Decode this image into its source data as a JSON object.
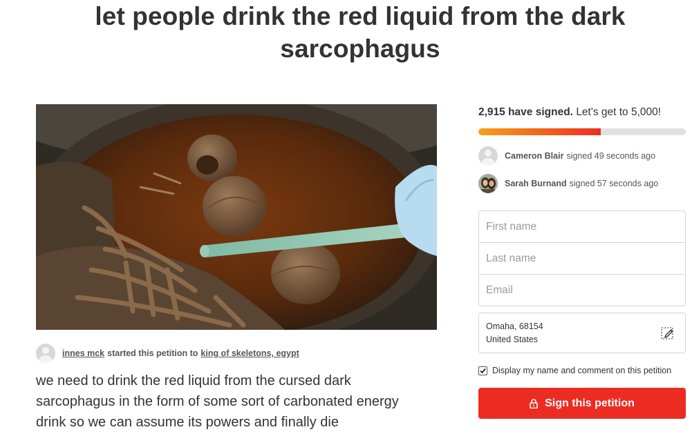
{
  "petition": {
    "title": "let people drink the red liquid from the dark sarcophagus",
    "starter_name": "innes mck",
    "starter_mid": "started this petition to",
    "target": "king of skeletons, egypt",
    "description": "we need to drink the red liquid from the cursed dark sarcophagus in the form of some sort of carbonated energy drink so we can assume its powers and finally die"
  },
  "signatures": {
    "count_text": "2,915 have signed.",
    "goal_text": "Let's get to 5,000!",
    "progress_fraction": 0.59,
    "recent": [
      {
        "name": "Cameron Blair",
        "action": "signed 49 seconds ago",
        "avatar": "default-user-icon"
      },
      {
        "name": "Sarah Burnand",
        "action": "signed 57 seconds ago",
        "avatar": "photo"
      }
    ]
  },
  "form": {
    "first_name_placeholder": "First name",
    "last_name_placeholder": "Last name",
    "email_placeholder": "Email",
    "location_line1": "Omaha, 68154",
    "location_line2": "United States",
    "consent_label": "Display my name and comment on this petition",
    "consent_checked": true,
    "submit_label": "Sign this petition"
  },
  "colors": {
    "accent": "#ec2c22",
    "progress_start": "#f6a019",
    "progress_end": "#ec2c22",
    "text": "#333333"
  }
}
